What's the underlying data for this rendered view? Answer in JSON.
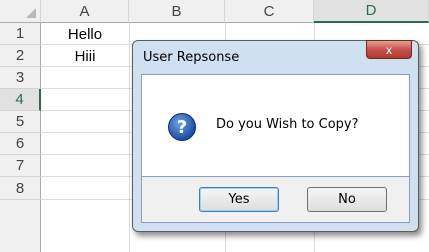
{
  "sheet": {
    "columns": [
      "A",
      "B",
      "C",
      "D"
    ],
    "selected_column": "D",
    "rows": [
      "1",
      "2",
      "3",
      "4",
      "5",
      "6",
      "7",
      "8"
    ],
    "selected_row": "4",
    "cells": {
      "A1": "Hello",
      "A2": "Hiii"
    }
  },
  "dialog": {
    "title": "User Repsonse",
    "close_symbol": "x",
    "icon": "question-icon",
    "icon_glyph": "?",
    "message": "Do you Wish to Copy?",
    "buttons": {
      "yes": "Yes",
      "no": "No"
    }
  },
  "colors": {
    "excel_green": "#217346",
    "dialog_frame": "#cfe0f1",
    "close_red": "#c75050"
  }
}
